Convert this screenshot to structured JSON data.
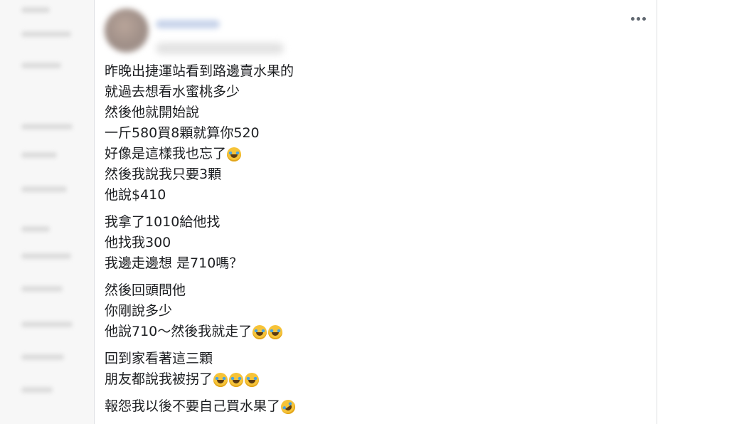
{
  "post": {
    "paragraphs": [
      [
        {
          "text": "昨晚出捷運站看到路邊賣水果的",
          "emojis": []
        },
        {
          "text": "就過去想看水蜜桃多少",
          "emojis": []
        },
        {
          "text": "然後他就開始說",
          "emojis": []
        },
        {
          "text": "一斤580買8顆就算你520",
          "emojis": []
        },
        {
          "text": "好像是這樣我也忘了",
          "emojis": [
            "face-with-tears-of-joy-icon"
          ]
        },
        {
          "text": "然後我說我只要3顆",
          "emojis": []
        },
        {
          "text": "他說$410",
          "emojis": []
        }
      ],
      [
        {
          "text": "我拿了1010給他找",
          "emojis": []
        },
        {
          "text": "他找我300",
          "emojis": []
        },
        {
          "text": "我邊走邊想 是710嗎？",
          "emojis": []
        }
      ],
      [
        {
          "text": "然後回頭問他",
          "emojis": []
        },
        {
          "text": "你剛說多少",
          "emojis": []
        },
        {
          "text": "他說710～然後我就走了",
          "emojis": [
            "face-with-tears-of-joy-icon",
            "face-with-tears-of-joy-icon"
          ]
        }
      ],
      [
        {
          "text": "回到家看著這三顆",
          "emojis": []
        },
        {
          "text": "朋友都說我被拐了",
          "emojis": [
            "face-with-tears-of-joy-icon",
            "face-with-tears-of-joy-icon",
            "face-with-tears-of-joy-icon"
          ]
        }
      ],
      [
        {
          "text": "報怨我以後不要自己買水果了",
          "emojis": [
            "rolling-on-the-floor-laughing-icon"
          ]
        }
      ]
    ]
  },
  "colors": {
    "text": "#1c1e21",
    "emoji_yellow": "#f6c338",
    "more_dots": "#606770"
  }
}
